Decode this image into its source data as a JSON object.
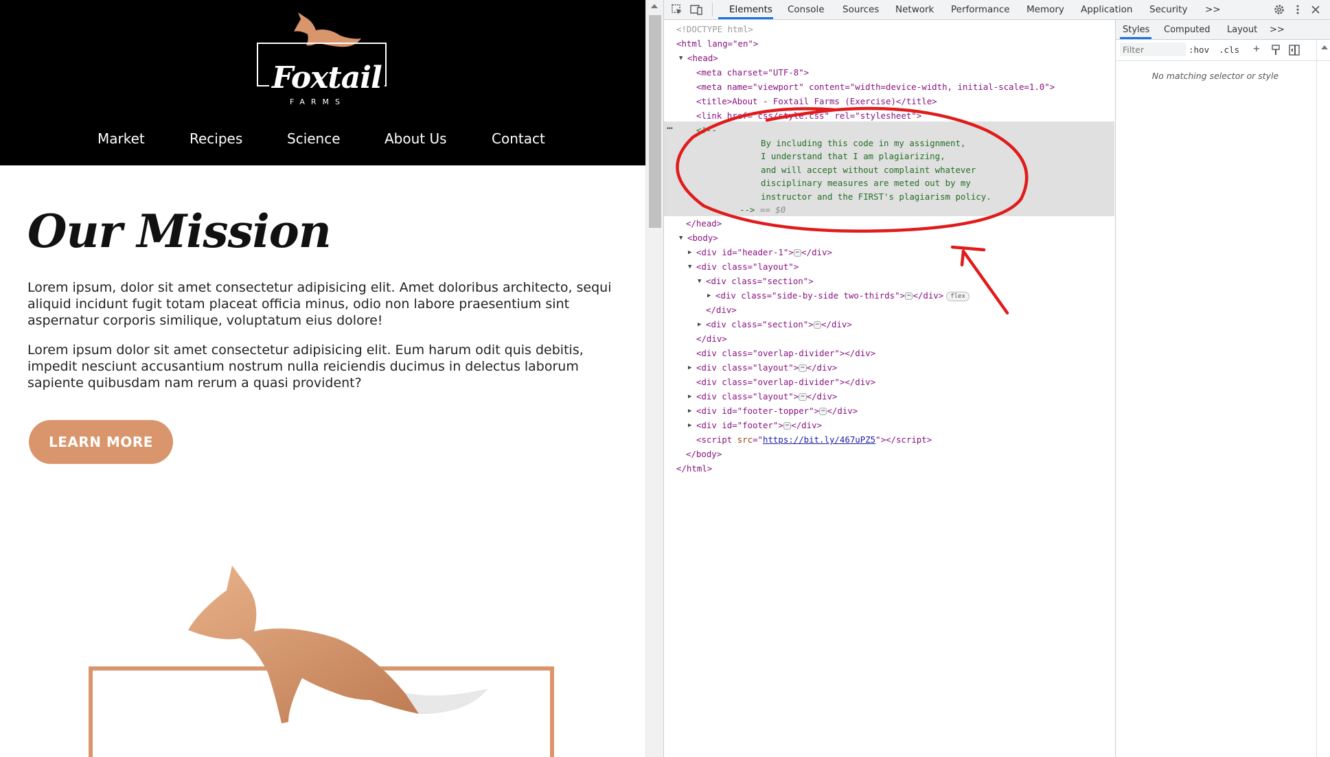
{
  "site": {
    "logo": {
      "name": "Foxtail",
      "sub": "FARMS"
    },
    "nav": [
      {
        "label": "Market"
      },
      {
        "label": "Recipes"
      },
      {
        "label": "Science"
      },
      {
        "label": "About Us"
      },
      {
        "label": "Contact"
      }
    ],
    "mission_title": "Our Mission",
    "para1": "Lorem ipsum, dolor sit amet consectetur adipisicing elit. Amet doloribus architecto, sequi aliquid incidunt fugit totam placeat officia minus, odio non labore praesentium sint aspernatur corporis similique, voluptatum eius dolore!",
    "para2": "Lorem ipsum dolor sit amet consectetur adipisicing elit. Eum harum odit quis debitis, impedit nesciunt accusantium nostrum nulla reiciendis ducimus in delectus laborum sapiente quibusdam nam rerum a quasi provident?",
    "cta": "LEARN MORE",
    "colors": {
      "accent": "#d9956b",
      "header_bg": "#000000"
    }
  },
  "devtools": {
    "tabs": [
      "Elements",
      "Console",
      "Sources",
      "Network",
      "Performance",
      "Memory",
      "Application",
      "Security"
    ],
    "more_tabs": ">>",
    "side_tabs": [
      "Styles",
      "Computed",
      "Layout"
    ],
    "side_more": ">>",
    "filter_placeholder": "Filter",
    "hov": ":hov",
    "cls": ".cls",
    "no_match": "No matching selector or style",
    "dom": {
      "doctype": "<!DOCTYPE html>",
      "html_open": "<html lang=\"en\">",
      "head_open": "<head>",
      "meta1": "<meta charset=\"UTF-8\">",
      "meta2": "<meta name=\"viewport\" content=\"width=device-width, initial-scale=1.0\">",
      "title": "<title>About - Foxtail Farms (Exercise)</title>",
      "link": "<link href=\"css/style.css\" rel=\"stylesheet\">",
      "comment_open": "<!--",
      "comment_lines": [
        "By including this code in my assignment,",
        "I understand that I am plagiarizing,",
        "and will accept without complaint whatever",
        "disciplinary measures are meted out by my",
        "instructor and the FIRST's plagiarism policy."
      ],
      "comment_close": "-->",
      "selected_marker": "== $0",
      "head_close": "</head>",
      "body_open": "<body>",
      "div_header": "<div id=\"header-1\">",
      "div_layout": "<div class=\"layout\">",
      "div_section": "<div class=\"section\">",
      "div_sbs": "<div class=\"side-by-side two-thirds\">",
      "flex_badge": "flex",
      "div_close": "</div>",
      "div_overlap": "<div class=\"overlap-divider\"></div>",
      "div_footer_topper": "<div id=\"footer-topper\">",
      "div_footer": "<div id=\"footer\">",
      "script": "https://bit.ly/467uPZ5",
      "body_close": "</body>",
      "html_close": "</html>"
    }
  }
}
